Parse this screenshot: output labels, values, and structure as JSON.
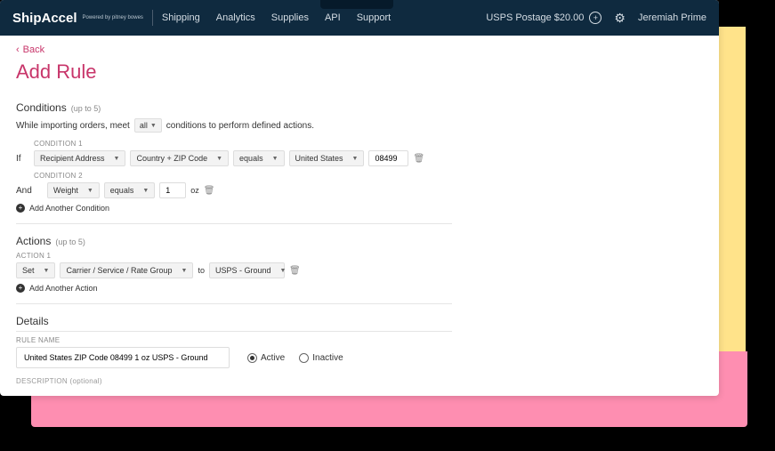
{
  "header": {
    "logo_main": "ShipAccel",
    "logo_sub": "Powered by pitney bowes",
    "nav": [
      "Shipping",
      "Analytics",
      "Supplies",
      "API",
      "Support"
    ],
    "postage_label": "USPS Postage $20.00",
    "user_name": "Jeremiah Prime"
  },
  "page": {
    "back": "Back",
    "title": "Add Rule"
  },
  "conditions": {
    "heading": "Conditions",
    "limit": "(up to 5)",
    "intro_before": "While importing orders, meet",
    "intro_match": "all",
    "intro_after": "conditions to perform defined actions.",
    "items": [
      {
        "label": "CONDITION 1",
        "prefix": "If",
        "field": "Recipient Address",
        "subfield": "Country + ZIP Code",
        "operator": "equals",
        "value_select": "United States",
        "value_text": "08499"
      },
      {
        "label": "CONDITION 2",
        "prefix": "And",
        "field": "Weight",
        "operator": "equals",
        "value_text": "1",
        "unit": "oz"
      }
    ],
    "add_label": "Add Another Condition"
  },
  "actions": {
    "heading": "Actions",
    "limit": "(up to 5)",
    "items": [
      {
        "label": "ACTION 1",
        "verb": "Set",
        "field": "Carrier / Service / Rate Group",
        "conjunction": "to",
        "value": "USPS - Ground"
      }
    ],
    "add_label": "Add Another Action"
  },
  "details": {
    "heading": "Details",
    "name_label": "RULE NAME",
    "name_value": "United States ZIP Code 08499 1 oz USPS - Ground",
    "status_active": "Active",
    "status_inactive": "Inactive",
    "selected_status": "Active",
    "desc_label": "DESCRIPTION (optional)"
  }
}
